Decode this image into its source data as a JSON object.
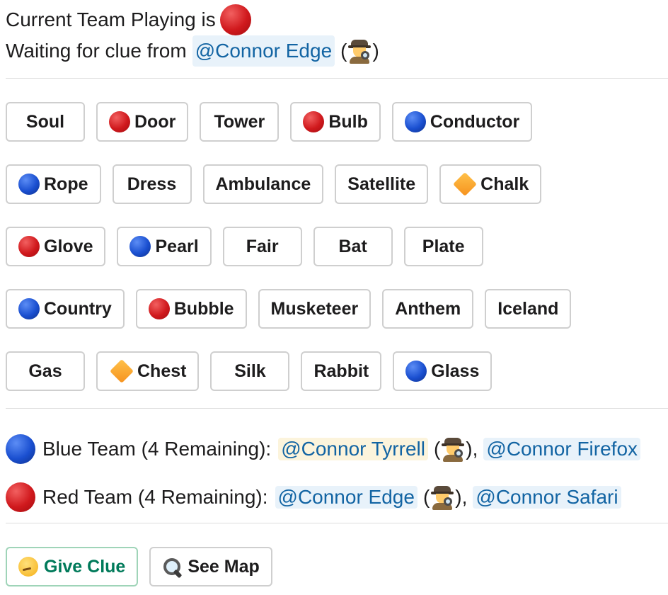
{
  "status": {
    "current_team_label": "Current Team Playing is",
    "current_team_color": "red",
    "waiting_label": "Waiting for clue from",
    "waiting_user": "@Connor Edge",
    "paren_open": "(",
    "paren_close": ")",
    "waiting_user_role_icon": "detective-icon"
  },
  "board": {
    "rows": [
      [
        {
          "word": "Soul",
          "marker": "none"
        },
        {
          "word": "Door",
          "marker": "red"
        },
        {
          "word": "Tower",
          "marker": "none"
        },
        {
          "word": "Bulb",
          "marker": "red"
        },
        {
          "word": "Conductor",
          "marker": "blue"
        }
      ],
      [
        {
          "word": "Rope",
          "marker": "blue"
        },
        {
          "word": "Dress",
          "marker": "none"
        },
        {
          "word": "Ambulance",
          "marker": "none"
        },
        {
          "word": "Satellite",
          "marker": "none"
        },
        {
          "word": "Chalk",
          "marker": "orange-diamond"
        }
      ],
      [
        {
          "word": "Glove",
          "marker": "red"
        },
        {
          "word": "Pearl",
          "marker": "blue"
        },
        {
          "word": "Fair",
          "marker": "none"
        },
        {
          "word": "Bat",
          "marker": "none"
        },
        {
          "word": "Plate",
          "marker": "none"
        }
      ],
      [
        {
          "word": "Country",
          "marker": "blue"
        },
        {
          "word": "Bubble",
          "marker": "red"
        },
        {
          "word": "Musketeer",
          "marker": "none"
        },
        {
          "word": "Anthem",
          "marker": "none"
        },
        {
          "word": "Iceland",
          "marker": "none"
        }
      ],
      [
        {
          "word": "Gas",
          "marker": "none"
        },
        {
          "word": "Chest",
          "marker": "orange-diamond"
        },
        {
          "word": "Silk",
          "marker": "none"
        },
        {
          "word": "Rabbit",
          "marker": "none"
        },
        {
          "word": "Glass",
          "marker": "blue"
        }
      ]
    ]
  },
  "teams": {
    "blue": {
      "label": "Blue Team (4 Remaining):",
      "spymaster": "@Connor Tyrrell",
      "spymaster_icon": "detective-icon",
      "member": "@Connor Firefox",
      "paren_open": "(",
      "paren_close": "),"
    },
    "red": {
      "label": "Red Team (4 Remaining):",
      "spymaster": "@Connor Edge",
      "spymaster_icon": "detective-icon",
      "member": "@Connor Safari",
      "paren_open": "(",
      "paren_close": "),"
    }
  },
  "actions": {
    "give_clue_label": "Give Clue",
    "give_clue_icon": "thinking-face-icon",
    "see_map_label": "See Map",
    "see_map_icon": "magnifying-glass-icon"
  },
  "colors": {
    "red": "#d0191d",
    "blue": "#1a4fd0",
    "orange": "#f6921e",
    "mention_text": "#1264a3",
    "mention_bg": "#e8f2fa",
    "primary_green": "#007a5a"
  }
}
